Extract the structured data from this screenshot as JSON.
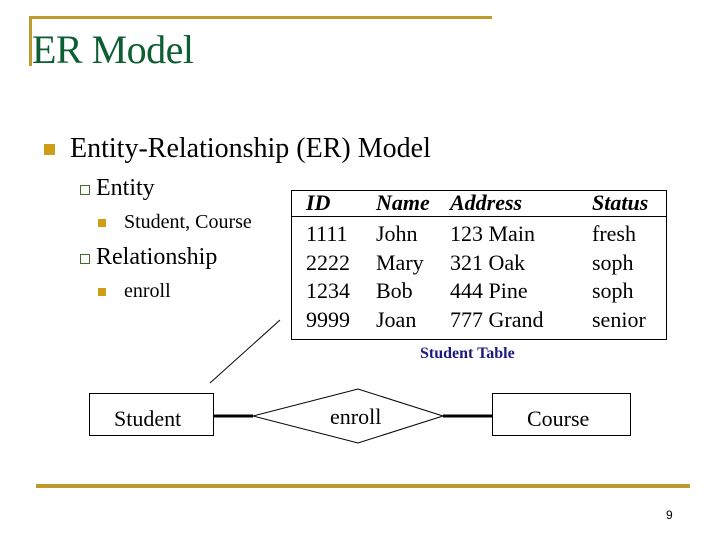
{
  "slide": {
    "title": "ER Model",
    "page_number": "9",
    "accent_color": "#c09a2c",
    "title_color": "#0d5e33",
    "bullet_color": "#cf9d16"
  },
  "outline": {
    "level1": "Entity-Relationship (ER) Model",
    "items": [
      {
        "label": "Entity",
        "sub": "Student, Course"
      },
      {
        "label": "Relationship",
        "sub": "enroll"
      }
    ]
  },
  "student_table": {
    "caption": "Student Table",
    "caption_color": "#1a1a80",
    "headers": [
      "ID",
      "Name",
      "Address",
      "Status"
    ],
    "rows": [
      [
        "1111",
        "John",
        "123 Main",
        "fresh"
      ],
      [
        "2222",
        "Mary",
        "321 Oak",
        "soph"
      ],
      [
        "1234",
        "Bob",
        "444 Pine",
        "soph"
      ],
      [
        "9999",
        "Joan",
        "777 Grand",
        "senior"
      ]
    ]
  },
  "er_diagram": {
    "entity_left": "Student",
    "relationship": "enroll",
    "entity_right": "Course"
  }
}
